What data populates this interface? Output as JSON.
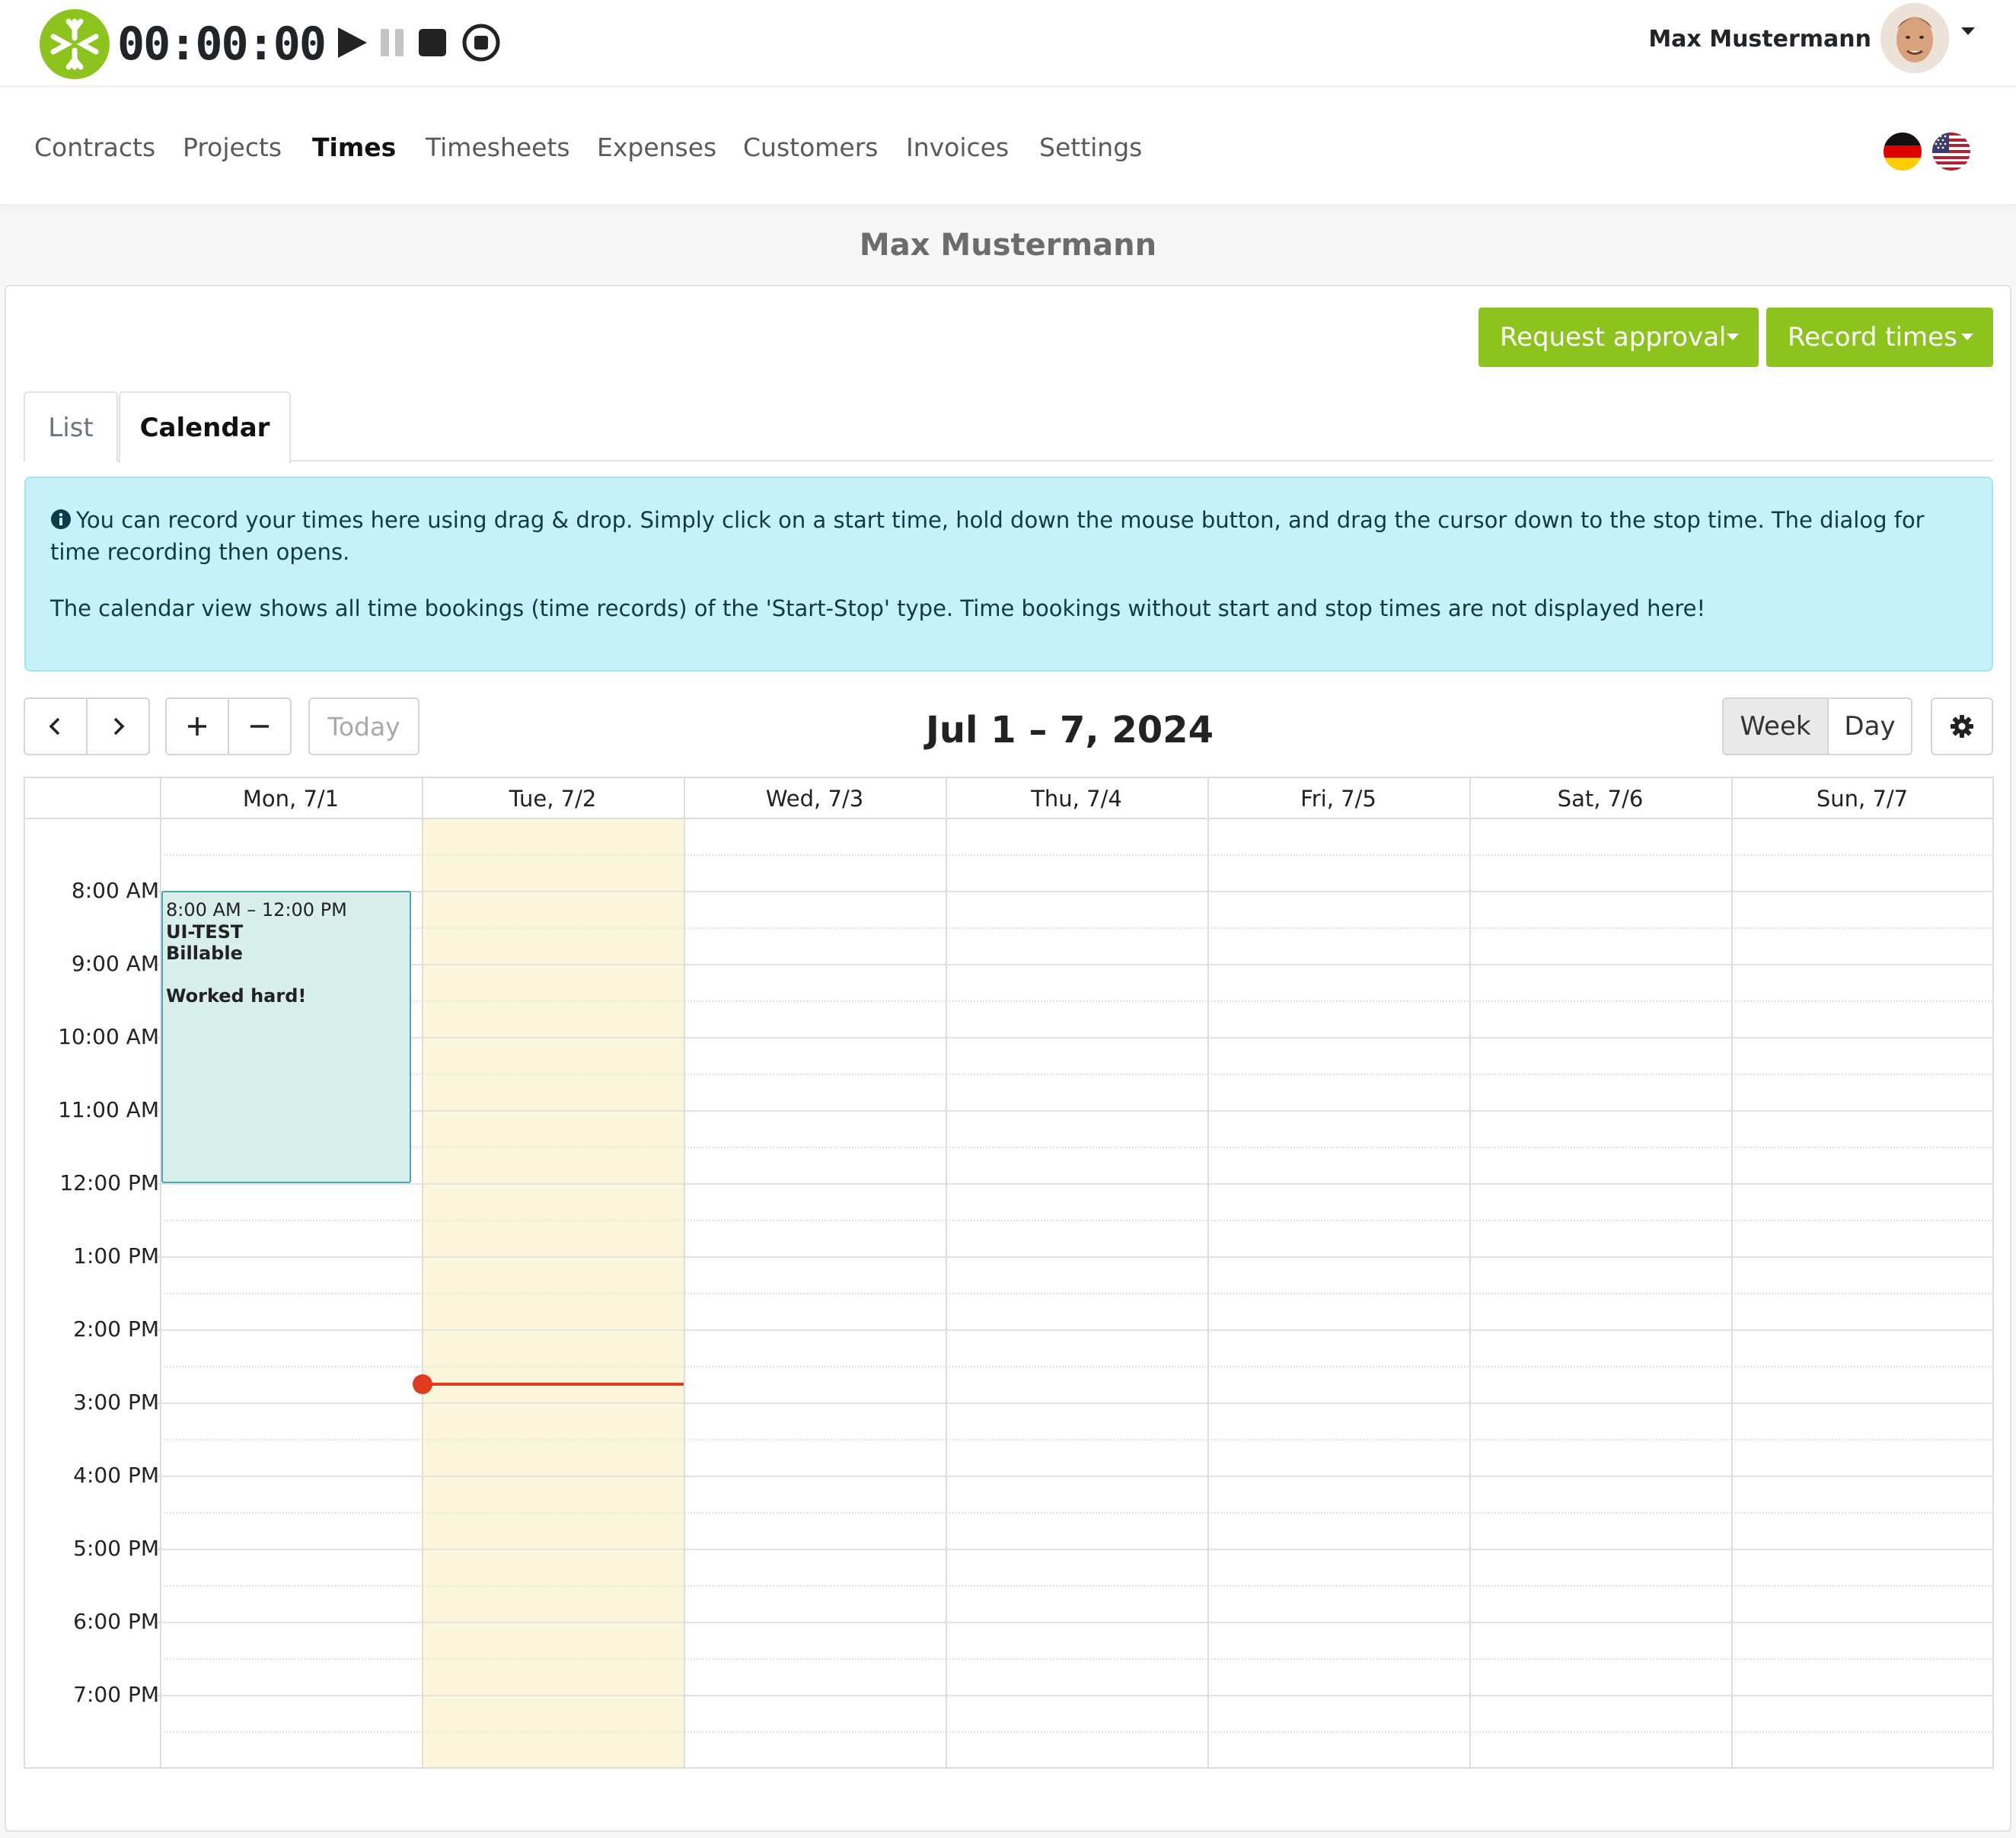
{
  "timer": {
    "display": "00:00:00",
    "controls": [
      "play-icon",
      "pause-icon",
      "stop-icon",
      "record-icon"
    ]
  },
  "user": {
    "name": "Max Mustermann"
  },
  "nav": {
    "items": [
      {
        "label": "Contracts",
        "active": false
      },
      {
        "label": "Projects",
        "active": false
      },
      {
        "label": "Times",
        "active": true
      },
      {
        "label": "Timesheets",
        "active": false
      },
      {
        "label": "Expenses",
        "active": false
      },
      {
        "label": "Customers",
        "active": false
      },
      {
        "label": "Invoices",
        "active": false
      },
      {
        "label": "Settings",
        "active": false
      }
    ],
    "languages": [
      "german-flag-icon",
      "us-flag-icon"
    ]
  },
  "page": {
    "title": "Max Mustermann"
  },
  "actions": {
    "request_approval": "Request approval",
    "record_times": "Record times"
  },
  "tabs": {
    "list": "List",
    "calendar": "Calendar",
    "active": "Calendar"
  },
  "alert": {
    "line1": "You can record your times here using drag & drop. Simply click on a start time, hold down the mouse button, and drag the cursor down to the stop time. The dialog for time recording then opens.",
    "line2": "The calendar view shows all time bookings (time records) of the 'Start-Stop' type. Time bookings without start and stop times are not displayed here!"
  },
  "calendar": {
    "title": "Jul 1 – 7, 2024",
    "today_label": "Today",
    "views": {
      "week": "Week",
      "day": "Day",
      "active": "Week"
    },
    "days": [
      "Mon, 7/1",
      "Tue, 7/2",
      "Wed, 7/3",
      "Thu, 7/4",
      "Fri, 7/5",
      "Sat, 7/6",
      "Sun, 7/7"
    ],
    "today_index": 1,
    "times": [
      "8:00 AM",
      "9:00 AM",
      "10:00 AM",
      "11:00 AM",
      "12:00 PM",
      "1:00 PM",
      "2:00 PM",
      "3:00 PM",
      "4:00 PM",
      "5:00 PM",
      "6:00 PM",
      "7:00 PM"
    ],
    "events": [
      {
        "day_index": 0,
        "time": "8:00 AM – 12:00 PM",
        "project": "UI-TEST",
        "billing": "Billable",
        "note": "Worked hard!"
      }
    ]
  }
}
